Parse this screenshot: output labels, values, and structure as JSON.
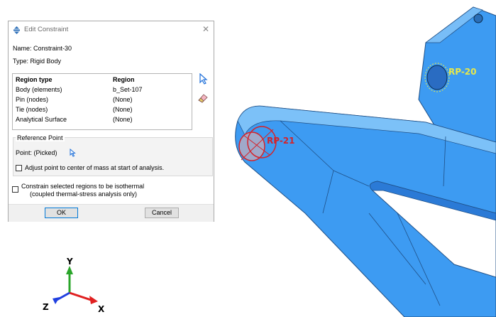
{
  "dialog": {
    "title": "Edit Constraint",
    "name_text": "Name:  Constraint-30",
    "type_text": "Type:   Rigid Body",
    "table": {
      "headers": [
        "Region type",
        "Region"
      ],
      "rows": [
        {
          "type": "Body (elements)",
          "region": "b_Set-107"
        },
        {
          "type": "Pin (nodes)",
          "region": "(None)"
        },
        {
          "type": "Tie (nodes)",
          "region": "(None)"
        },
        {
          "type": "Analytical Surface",
          "region": "(None)"
        }
      ]
    },
    "reference_point": {
      "legend": "Reference Point",
      "point_text": "Point:  (Picked)",
      "adjust_label": "Adjust point to center of mass at start of analysis."
    },
    "isothermal_line1": "Constrain selected regions to be isothermal",
    "isothermal_line2": "(coupled thermal-stress analysis only)",
    "ok_label": "OK",
    "cancel_label": "Cancel"
  },
  "viewport": {
    "rp21_label": "RP-21",
    "rp20_label": "RP-20"
  },
  "triad": {
    "x": "X",
    "y": "Y",
    "z": "Z"
  },
  "colors": {
    "part_blue": "#3d9bf2",
    "rp21_red": "#d4232a",
    "rp20_yellow": "#e8e84a",
    "selection_blue": "#1e6fd9"
  }
}
